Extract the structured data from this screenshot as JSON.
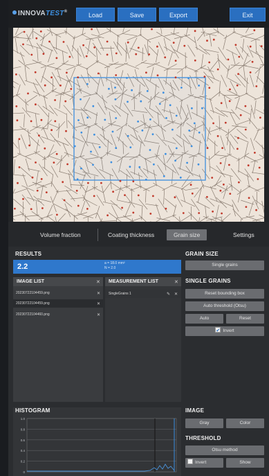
{
  "app": {
    "logo_main": "INNOVA",
    "logo_accent": "TEST",
    "logo_mark": "®"
  },
  "toolbar": {
    "load": "Load",
    "save": "Save",
    "export": "Export",
    "exit": "Exit"
  },
  "tabs": [
    {
      "label": "Volume fraction",
      "active": false
    },
    {
      "label": "Coating thickness",
      "active": false
    },
    {
      "label": "Grain size",
      "active": true
    },
    {
      "label": "Settings",
      "active": false
    }
  ],
  "results": {
    "header": "RESULTS",
    "value": "2.2",
    "info_line1": "a = 18.0 mm²",
    "info_line2": "N = 2.0"
  },
  "image_list": {
    "header": "IMAGE LIST",
    "items": [
      "20230722104459.png",
      "20230722104459.png",
      "20230722104460.png"
    ],
    "selected_index": 1
  },
  "measurement_list": {
    "header": "MEASUREMENT LIST",
    "items": [
      "SingleGrains 1"
    ]
  },
  "grain_size": {
    "header": "GRAIN SIZE",
    "single_grains_button": "Single grains",
    "single_grains_header": "SINGLE GRAINS",
    "reset_button": "Reset bounding box",
    "auto_threshold_button": "Auto threshold (Otsu)",
    "auto_button": "Auto",
    "reset_small_button": "Reset",
    "invert_label": "Invert",
    "invert_checked": true
  },
  "histogram": {
    "header": "HISTOGRAM",
    "y_ticks": [
      "1.0",
      "0.8",
      "0.6",
      "0.4",
      "0.2",
      "0"
    ]
  },
  "image_panel": {
    "header": "IMAGE",
    "gray_button": "Gray",
    "color_button": "Color",
    "threshold_header": "THRESHOLD",
    "otsu_button": "Otsu method",
    "invert_label": "Invert",
    "invert_checked": false,
    "show_button": "Show"
  },
  "colors": {
    "accent": "#2a6fc0",
    "grain_marker": "#c0392b",
    "roi_marker": "#3d8fe0",
    "background": "#222427"
  },
  "icons": [
    "close-icon",
    "edit-icon",
    "checkbox-icon"
  ]
}
